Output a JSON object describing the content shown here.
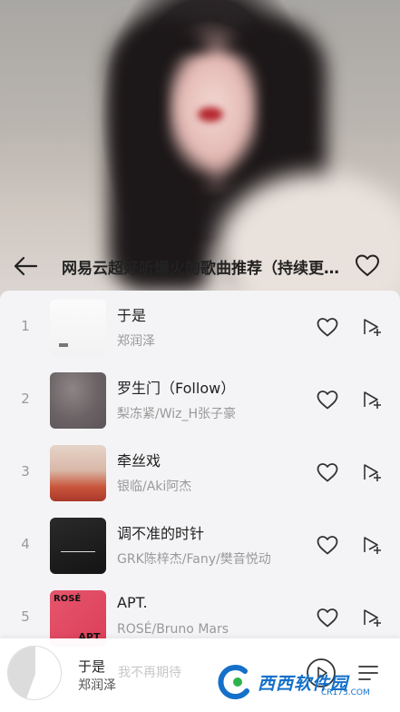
{
  "header": {
    "title": "网易云超好听爆火的歌曲推荐（持续更新）",
    "back_icon": "arrow-left-icon",
    "favorite_icon": "heart-outline-icon"
  },
  "songs": [
    {
      "index": "1",
      "title": "于是",
      "artist": "郑润泽"
    },
    {
      "index": "2",
      "title": "罗生门（Follow）",
      "artist": "梨冻紧/Wiz_H张子豪"
    },
    {
      "index": "3",
      "title": "牵丝戏",
      "artist": "银临/Aki阿杰"
    },
    {
      "index": "4",
      "title": "调不准的时针",
      "artist": "GRK陈梓杰/Fany/樊音悦动"
    },
    {
      "index": "5",
      "title": "APT.",
      "artist": "ROSÉ/Bruno Mars",
      "cover_text_top": "ROSÉ",
      "cover_text_bottom": "APT."
    }
  ],
  "player": {
    "song": "于是",
    "artist": "郑润泽",
    "lyric": "我不再期待",
    "play_icon": "play-circle-icon",
    "list_icon": "playlist-icon"
  },
  "watermark": {
    "text": "西西软件园",
    "url": "CR173.COM"
  }
}
